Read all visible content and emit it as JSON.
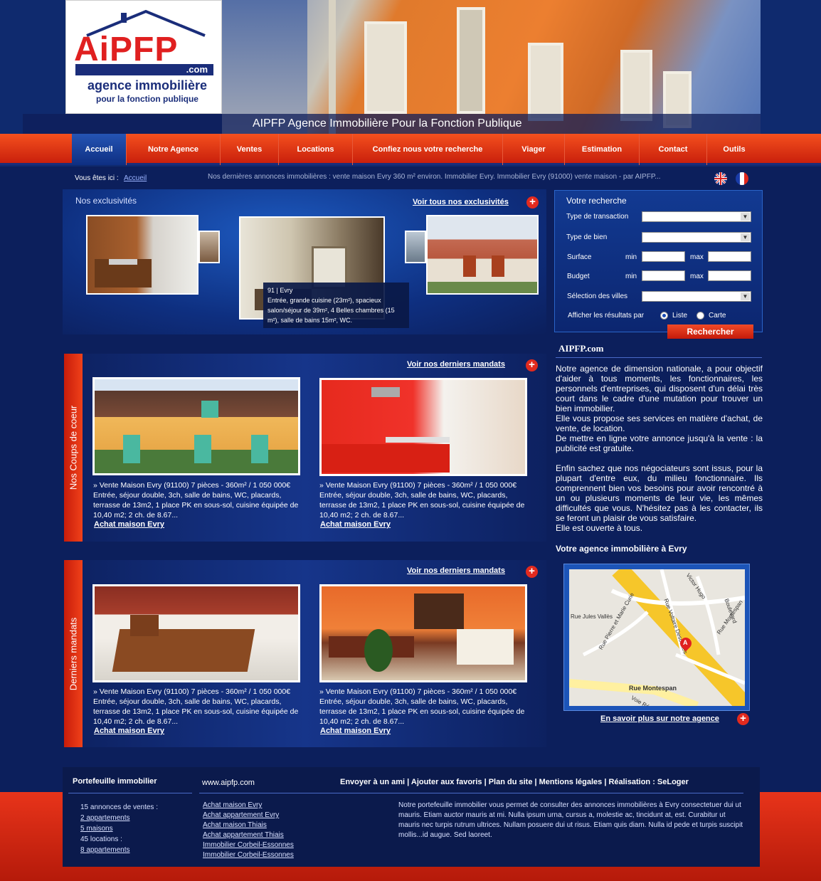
{
  "logo": {
    "main": "AiPFP",
    "com": ".com",
    "sub1": "agence immobilière",
    "sub2": "pour la fonction publique"
  },
  "header": {
    "title": "AIPFP Agence Immobilière Pour la Fonction Publique"
  },
  "nav": {
    "items": [
      "Accueil",
      "Notre Agence",
      "Ventes",
      "Locations",
      "Confiez nous votre recherche",
      "Viager",
      "Estimation",
      "Contact",
      "Outils"
    ]
  },
  "breadcrumb": {
    "label": "Vous êtes ici :",
    "link": "Accueil"
  },
  "ticker": "Nos dernières annonces immobilières : vente maison Evry 360 m² environ. Immobilier Evry.  Immobilier Evry (91000) vente maison - par AIPFP...",
  "exclusives": {
    "title": "Nos exclusivités",
    "more": "Voir tous nos exclusivités",
    "caption_line1": "91 | Evry",
    "caption_line2": "Entrée, grande cuisine (23m²), spacieux salon/séjour de 39m², 4 Belles chambres (15 m²), salle de bains 15m², WC."
  },
  "search": {
    "title": "Votre recherche",
    "type_transaction": "Type de transaction",
    "type_bien": "Type de bien",
    "surface": "Surface",
    "budget": "Budget",
    "min": "min",
    "max": "max",
    "villes": "Sélection des villes",
    "display_label": "Afficher les résultats par",
    "opt_liste": "Liste",
    "opt_carte": "Carte",
    "button": "Rechercher"
  },
  "about": {
    "title": "AIPFP.com",
    "p1": "Notre agence de dimension nationale, a pour objectif d'aider à tous moments, les fonctionnaires, les personnels d'entreprises, qui disposent d'un délai très court dans le cadre d'une mutation pour trouver un bien immobilier.",
    "p2": "Elle vous propose ses services en matière d'achat, de vente, de location.",
    "p3": "De mettre en ligne votre annonce jusqu'à la vente : la publicité est gratuite.",
    "p4": "Enfin sachez que nos négociateurs sont issus, pour la plupart d'entre eux, du milieu fonctionnaire. Ils comprennent bien vos besoins pour avoir rencontré à un ou plusieurs moments de leur vie, les mêmes difficultés que vous. N'hésitez pas à les contacter, ils se feront un plaisir de vous satisfaire.",
    "p5": "Elle est ouverte à tous."
  },
  "agency": {
    "title": "Votre agence  immobilière à Evry",
    "more": "En savoir plus sur notre agence",
    "map_labels": [
      "Rue Jules Vallès",
      "Rue Pierre et Marie Curie",
      "Rue Voltaire Descartes",
      "Victor Hugo",
      "Boulevard",
      "Rue Montespan",
      "Rue Montespan",
      "Voie Ré"
    ],
    "marker": "A"
  },
  "coups": {
    "side": "Nos Coups de coeur",
    "more": "Voir nos derniers mandats",
    "listings": [
      {
        "title": "» Vente Maison Evry (91100) 7 pièces - 360m² / 1 050 000€",
        "desc": "Entrée, séjour double, 3ch, salle de bains, WC, placards, terrasse de 13m2, 1 place PK en sous-sol, cuisine équipée de 10,40 m2; 2 ch. de 8.67...",
        "link": "Achat maison Evry"
      },
      {
        "title": "» Vente Maison Evry (91100) 7 pièces - 360m² / 1 050 000€",
        "desc": "Entrée, séjour double, 3ch, salle de bains, WC, placards, terrasse de 13m2, 1 place PK en sous-sol, cuisine équipée de 10,40 m2; 2 ch. de 8.67...",
        "link": "Achat maison Evry"
      }
    ]
  },
  "mandats": {
    "side": "Derniers mandats",
    "more": "Voir nos derniers mandats",
    "listings": [
      {
        "title": "» Vente Maison Evry (91100) 7 pièces - 360m² / 1 050 000€",
        "desc": "Entrée, séjour double, 3ch, salle de bains, WC, placards, terrasse de 13m2, 1 place PK en sous-sol, cuisine équipée de 10,40 m2; 2 ch. de 8.67...",
        "link": "Achat maison Evry"
      },
      {
        "title": "» Vente Maison Evry (91100) 7 pièces - 360m² / 1 050 000€",
        "desc": "Entrée, séjour double, 3ch, salle de bains, WC, placards, terrasse de 13m2, 1 place PK en sous-sol, cuisine équipée de 10,40 m2; 2 ch. de 8.67...",
        "link": "Achat maison Evry"
      }
    ]
  },
  "footer": {
    "portfolio_title": "Portefeuille immobilier",
    "ventes_count": "15 annonces de ventes :",
    "ventes_apparts": "2 appartements",
    "ventes_maisons": "5 maisons",
    "locations_count": "45 locations :",
    "locations_apparts": "8 appartements",
    "site": "www.aipfp.com",
    "site_links": [
      "Achat maison Evry",
      "Achat appartement Evry",
      "Achat maison Thiais",
      "Achat appartement Thiais",
      "Immobilier Corbeil-Essonnes ",
      "Immobilier Corbeil-Essonnes "
    ],
    "links_line": "Envoyer à un ami   |   Ajouter aux favoris   |   Plan du site   |   Mentions légales  |  Réalisation : SeLoger",
    "description": "Notre portefeuille immobilier vous permet de consulter des annonces immobilières à Evry consectetuer dui ut mauris. Etiam auctor mauris at mi. Nulla ipsum urna, cursus a, molestie ac, tincidunt at, est. Curabitur ut mauris nec turpis rutrum ultrices. Nullam posuere dui ut risus. Etiam quis diam. Nulla id pede et turpis suscipit mollis...id augue. Sed laoreet."
  }
}
